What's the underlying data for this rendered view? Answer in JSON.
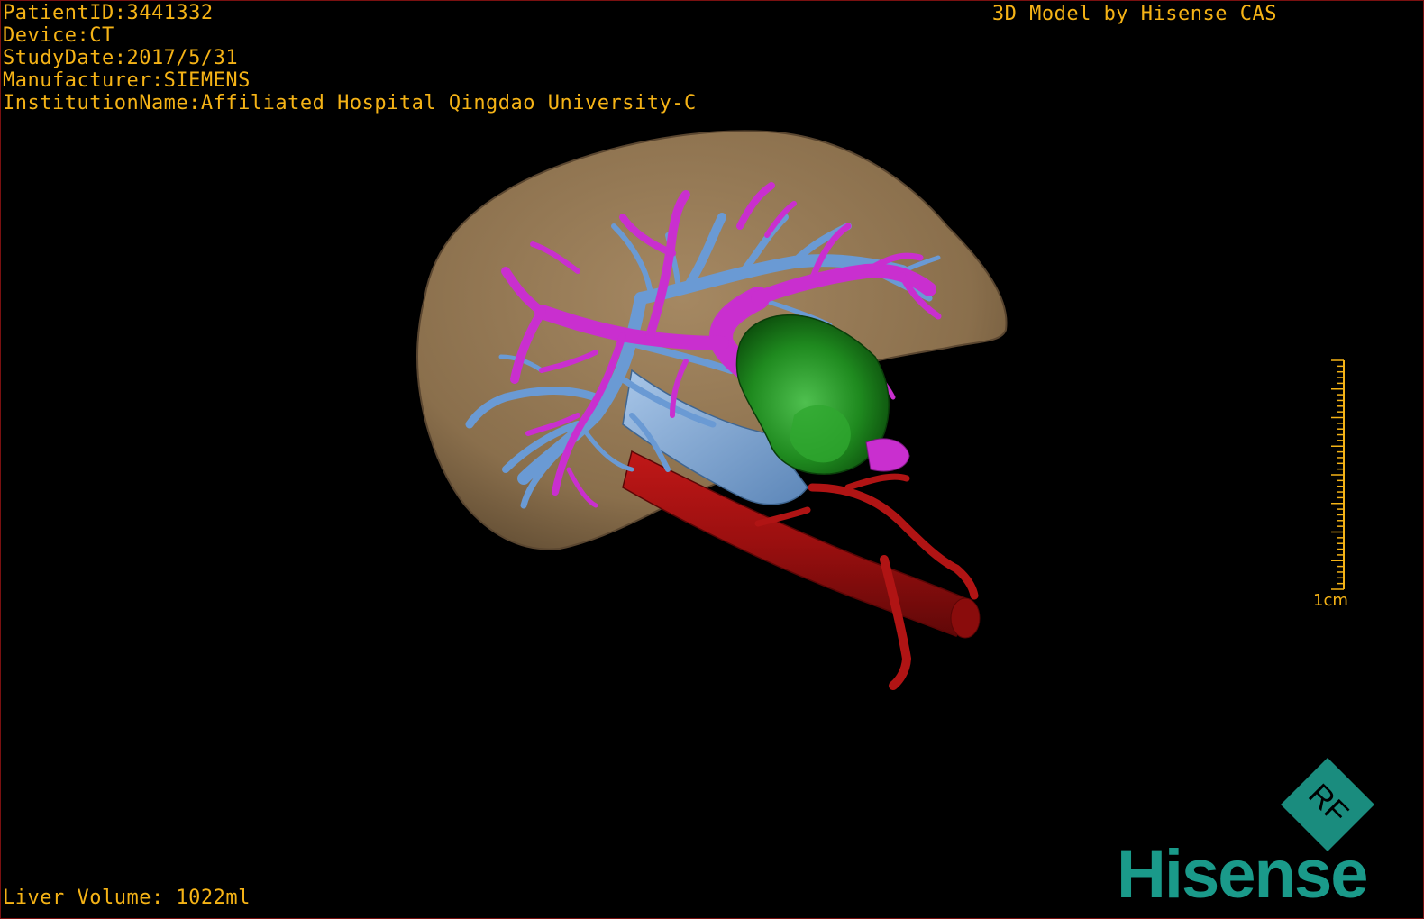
{
  "header": {
    "lines": [
      "PatientID:3441332",
      "Device:CT",
      "StudyDate:2017/5/31",
      "Manufacturer:SIEMENS",
      "InstitutionName:Affiliated Hospital Qingdao University-C"
    ],
    "credit": "3D Model by Hisense CAS"
  },
  "footer": {
    "liver_volume": "Liver Volume: 1022ml"
  },
  "scale_bar": {
    "label": "1cm"
  },
  "branding": {
    "logo_letters": "RF",
    "brand_name": "Hisense",
    "brand_color": "#1a9a8a"
  },
  "model": {
    "structures": [
      {
        "name": "liver",
        "color": "#8c7150"
      },
      {
        "name": "portal-vein",
        "color": "#c92fcf"
      },
      {
        "name": "hepatic-vein",
        "color": "#6a9ad4"
      },
      {
        "name": "vena-cava",
        "color": "#7fa8d8"
      },
      {
        "name": "aorta",
        "color": "#a01010"
      },
      {
        "name": "tumor",
        "color": "#1e8a1e"
      }
    ]
  }
}
